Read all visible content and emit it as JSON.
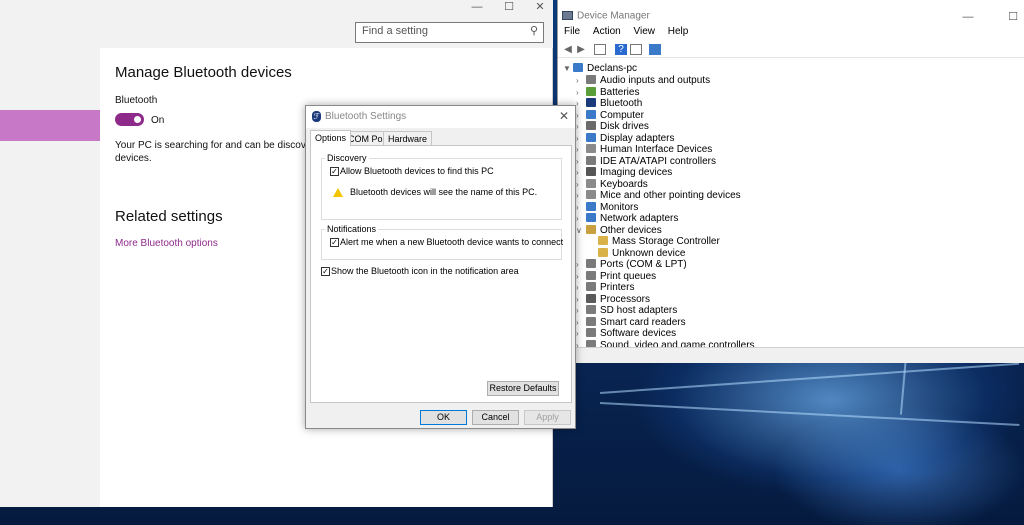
{
  "settings": {
    "search_placeholder": "Find a setting",
    "page_title": "Manage Bluetooth devices",
    "bluetooth_label": "Bluetooth",
    "toggle_state": "On",
    "status_line1": "Your PC is searching for and can be discovere",
    "status_line2": "devices.",
    "related_title": "Related settings",
    "more_link": "More Bluetooth options"
  },
  "devmgr": {
    "title": "Device Manager",
    "menu": [
      "File",
      "Action",
      "View",
      "Help"
    ],
    "root": "Declans-pc",
    "items": [
      {
        "label": "Audio inputs and outputs",
        "icon": "speaker-icon",
        "color": "#7a7a7a"
      },
      {
        "label": "Batteries",
        "icon": "battery-icon",
        "color": "#5a9e3a"
      },
      {
        "label": "Bluetooth",
        "icon": "bluetooth-icon",
        "color": "#1b3a7a"
      },
      {
        "label": "Computer",
        "icon": "computer-icon",
        "color": "#3a7ac8"
      },
      {
        "label": "Disk drives",
        "icon": "disk-icon",
        "color": "#6a6a6a"
      },
      {
        "label": "Display adapters",
        "icon": "display-icon",
        "color": "#3a7ac8"
      },
      {
        "label": "Human Interface Devices",
        "icon": "hid-icon",
        "color": "#8a8a8a"
      },
      {
        "label": "IDE ATA/ATAPI controllers",
        "icon": "ide-icon",
        "color": "#7a7a7a"
      },
      {
        "label": "Imaging devices",
        "icon": "camera-icon",
        "color": "#555555"
      },
      {
        "label": "Keyboards",
        "icon": "keyboard-icon",
        "color": "#8a8a8a"
      },
      {
        "label": "Mice and other pointing devices",
        "icon": "mouse-icon",
        "color": "#8a8a8a"
      },
      {
        "label": "Monitors",
        "icon": "monitor-icon",
        "color": "#3a7ac8"
      },
      {
        "label": "Network adapters",
        "icon": "network-icon",
        "color": "#3a7ac8"
      },
      {
        "label": "Other devices",
        "icon": "other-devices-icon",
        "color": "#c8a040",
        "expanded": true
      },
      {
        "label": "Ports (COM & LPT)",
        "icon": "port-icon",
        "color": "#7a7a7a"
      },
      {
        "label": "Print queues",
        "icon": "printer-icon",
        "color": "#7a7a7a"
      },
      {
        "label": "Printers",
        "icon": "printer-icon",
        "color": "#7a7a7a"
      },
      {
        "label": "Processors",
        "icon": "processor-icon",
        "color": "#5a5a5a"
      },
      {
        "label": "SD host adapters",
        "icon": "sd-icon",
        "color": "#7a7a7a"
      },
      {
        "label": "Smart card readers",
        "icon": "smartcard-icon",
        "color": "#7a7a7a"
      },
      {
        "label": "Software devices",
        "icon": "software-icon",
        "color": "#7a7a7a"
      },
      {
        "label": "Sound, video and game controllers",
        "icon": "sound-icon",
        "color": "#7a7a7a"
      }
    ],
    "other_children": [
      {
        "label": "Mass Storage Controller",
        "icon": "warning-device-icon"
      },
      {
        "label": "Unknown device",
        "icon": "warning-device-icon"
      }
    ]
  },
  "dialog": {
    "title": "Bluetooth Settings",
    "tabs": [
      "Options",
      "COM Ports",
      "Hardware"
    ],
    "discovery_label": "Discovery",
    "allow_label": "Allow Bluetooth devices to find this PC",
    "allow_checked": true,
    "warning_text": "Bluetooth devices will see the name of this PC.",
    "notifications_label": "Notifications",
    "alert_label": "Alert me when a new Bluetooth device wants to connect",
    "alert_checked": true,
    "show_icon_label": "Show the Bluetooth icon in the notification area",
    "show_icon_checked": true,
    "restore_label": "Restore Defaults",
    "ok_label": "OK",
    "cancel_label": "Cancel",
    "apply_label": "Apply"
  },
  "colors": {
    "accent": "#8e2a8a",
    "accent_highlight": "#c778c6"
  }
}
